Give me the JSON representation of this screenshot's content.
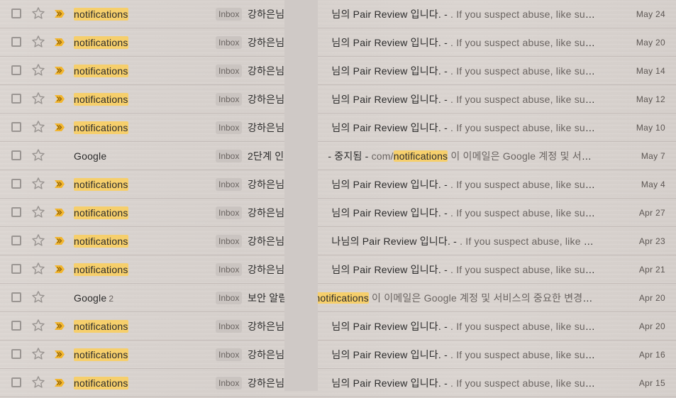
{
  "colors": {
    "highlight": "#f6cf6c",
    "importance_marker": "#f2b630",
    "star_outline": "#9a9592",
    "redaction": "#cfc9c6"
  },
  "icons": {
    "checkbox": "checkbox-icon",
    "star": "star-outline-icon",
    "importance": "importance-marker-icon"
  },
  "rows": [
    {
      "sender": "notifications",
      "sender_highlight": true,
      "count": "",
      "important": true,
      "label": "Inbox",
      "subject": "강하은님,",
      "subject_tail": "님의 Pair Review 입니다. -",
      "snippet": " . If you suspect abuse, like suspicious",
      "date": "May 24"
    },
    {
      "sender": "notifications",
      "sender_highlight": true,
      "count": "",
      "important": true,
      "label": "Inbox",
      "subject": "강하은님,",
      "subject_tail": "님의 Pair Review 입니다. -",
      "snippet": " . If you suspect abuse, like suspicious",
      "date": "May 20"
    },
    {
      "sender": "notifications",
      "sender_highlight": true,
      "count": "",
      "important": true,
      "label": "Inbox",
      "subject": "강하은님,",
      "subject_tail": "님의 Pair Review 입니다. -",
      "snippet": " . If you suspect abuse, like suspicious",
      "date": "May 14"
    },
    {
      "sender": "notifications",
      "sender_highlight": true,
      "count": "",
      "important": true,
      "label": "Inbox",
      "subject": "강하은님,",
      "subject_tail": "님의 Pair Review 입니다. -",
      "snippet": " . If you suspect abuse, like suspicious",
      "date": "May 12"
    },
    {
      "sender": "notifications",
      "sender_highlight": true,
      "count": "",
      "important": true,
      "label": "Inbox",
      "subject": "강하은님,",
      "subject_tail": "님의 Pair Review 입니다. -",
      "snippet": " . If you suspect abuse, like suspicious",
      "date": "May 10"
    },
    {
      "sender": "Google",
      "sender_highlight": false,
      "count": "",
      "important": false,
      "label": "Inbox",
      "subject": "2단계 인",
      "subject_tail": "- 중지됨 -",
      "snippet_pre": " com/",
      "snippet_term": "notifications",
      "snippet": " 이 이메일은 Google 계정 및 서비스의",
      "date": "May 7"
    },
    {
      "sender": "notifications",
      "sender_highlight": true,
      "count": "",
      "important": true,
      "label": "Inbox",
      "subject": "강하은님,",
      "subject_tail": "님의 Pair Review 입니다. -",
      "snippet": " . If you suspect abuse, like suspicious",
      "date": "May 4"
    },
    {
      "sender": "notifications",
      "sender_highlight": true,
      "count": "",
      "important": true,
      "label": "Inbox",
      "subject": "강하은님,",
      "subject_tail": "님의 Pair Review 입니다. -",
      "snippet": " . If you suspect abuse, like suspicious",
      "date": "Apr 27"
    },
    {
      "sender": "notifications",
      "sender_highlight": true,
      "count": "",
      "important": true,
      "label": "Inbox",
      "subject": "강하은님,",
      "subject_tail": "나님의 Pair Review 입니다. -",
      "snippet": " . If you suspect abuse, like suspicious",
      "date": "Apr 23"
    },
    {
      "sender": "notifications",
      "sender_highlight": true,
      "count": "",
      "important": true,
      "label": "Inbox",
      "subject": "강하은님,",
      "subject_tail": "님의 Pair Review 입니다. -",
      "snippet": " . If you suspect abuse, like suspicious",
      "date": "Apr 21"
    },
    {
      "sender": "Google",
      "sender_highlight": false,
      "count": "2",
      "important": false,
      "label": "Inbox",
      "subject": "보안 알림",
      "subject_tail": "",
      "snippet_pre": "",
      "snippet_term": "notifications",
      "snippet": " 이 이메일은 Google 계정 및 서비스의 중요한 변경사항",
      "date": "Apr 20"
    },
    {
      "sender": "notifications",
      "sender_highlight": true,
      "count": "",
      "important": true,
      "label": "Inbox",
      "subject": "강하은님,",
      "subject_tail": "님의 Pair Review 입니다. -",
      "snippet": " . If you suspect abuse, like suspicious",
      "date": "Apr 20"
    },
    {
      "sender": "notifications",
      "sender_highlight": true,
      "count": "",
      "important": true,
      "label": "Inbox",
      "subject": "강하은님,",
      "subject_tail": "님의 Pair Review 입니다. -",
      "snippet": " . If you suspect abuse, like suspicious",
      "date": "Apr 16"
    },
    {
      "sender": "notifications",
      "sender_highlight": true,
      "count": "",
      "important": true,
      "label": "Inbox",
      "subject": "강하은님,",
      "subject_tail": "님의 Pair Review 입니다. -",
      "snippet": " . If you suspect abuse, like suspicious",
      "date": "Apr 15"
    }
  ]
}
